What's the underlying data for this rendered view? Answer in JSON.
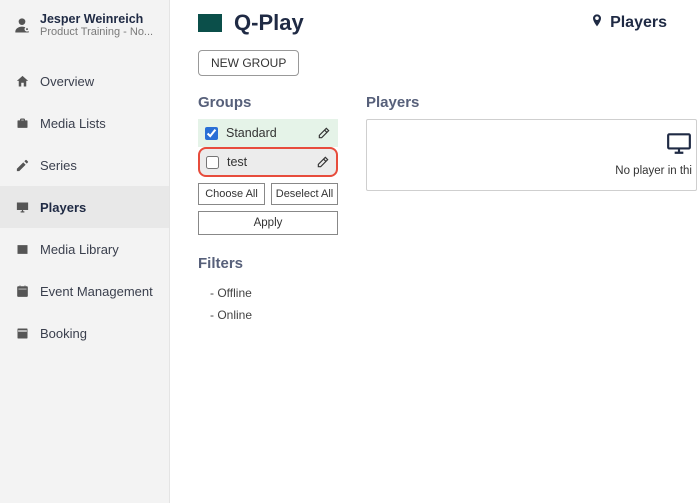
{
  "user": {
    "name": "Jesper Weinreich",
    "subtitle": "Product Training - No..."
  },
  "nav": {
    "overview": "Overview",
    "mediaLists": "Media Lists",
    "series": "Series",
    "players": "Players",
    "mediaLibrary": "Media Library",
    "eventManagement": "Event Management",
    "booking": "Booking"
  },
  "brand": {
    "title": "Q-Play"
  },
  "top": {
    "playersLink": "Players"
  },
  "buttons": {
    "newGroup": "NEW GROUP",
    "chooseAll": "Choose All",
    "deselectAll": "Deselect All",
    "apply": "Apply"
  },
  "sections": {
    "groups": "Groups",
    "players": "Players",
    "filters": "Filters"
  },
  "groups": {
    "items": [
      {
        "label": "Standard",
        "checked": true
      },
      {
        "label": "test",
        "checked": false
      }
    ]
  },
  "filters": {
    "offline": "- Offline",
    "online": "- Online"
  },
  "playersPanel": {
    "empty": "No player in thi"
  }
}
